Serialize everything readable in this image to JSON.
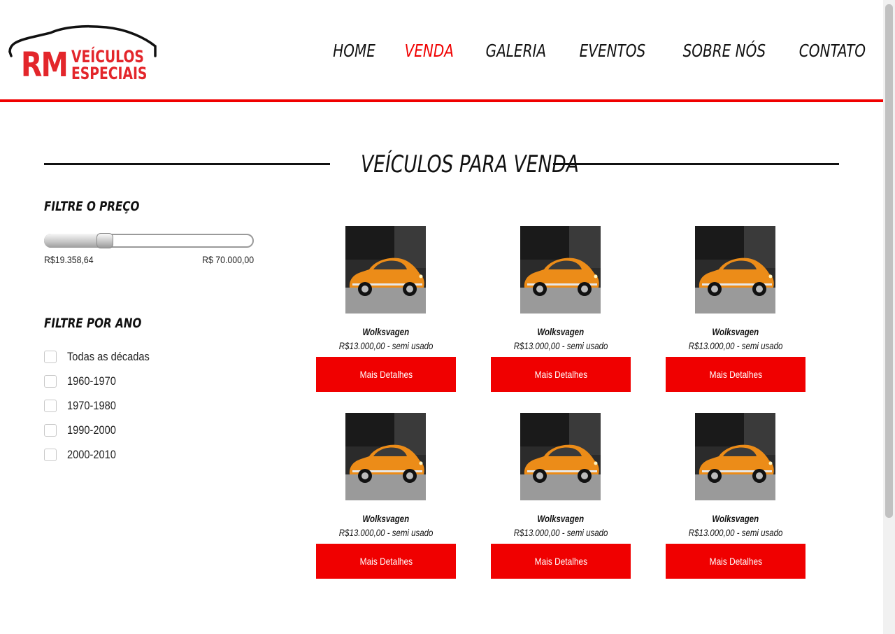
{
  "logo": {
    "initials": "RM",
    "line1": "VEÍCULOS",
    "line2": "ESPECIAIS",
    "color": "#e3262b"
  },
  "nav": [
    {
      "label": "HOME",
      "active": false
    },
    {
      "label": "VENDA",
      "active": true
    },
    {
      "label": "GALERIA",
      "active": false
    },
    {
      "label": "EVENTOS",
      "active": false
    },
    {
      "label": "SOBRE NÓS",
      "active": false
    },
    {
      "label": "CONTATO",
      "active": false
    }
  ],
  "section": {
    "title": "VEÍCULOS PARA VENDA"
  },
  "filters": {
    "price": {
      "heading": "FILTRE O PREÇO",
      "min_label": "R$19.358,64",
      "max_label": "R$ 70.000,00",
      "level_percent": 27
    },
    "year": {
      "heading": "FILTRE POR ANO",
      "options": [
        {
          "label": "Todas as décadas",
          "checked": false
        },
        {
          "label": "1960-1970",
          "checked": false
        },
        {
          "label": "1970-1980",
          "checked": false
        },
        {
          "label": "1990-2000",
          "checked": false
        },
        {
          "label": "2000-2010",
          "checked": false
        }
      ]
    }
  },
  "products": [
    {
      "name": "Wolksvagen",
      "price": "R$13.000,00 - semi usado",
      "button": "Mais Detalhes"
    },
    {
      "name": "Wolksvagen",
      "price": "R$13.000,00 - semi usado",
      "button": "Mais Detalhes"
    },
    {
      "name": "Wolksvagen",
      "price": "R$13.000,00 - semi usado",
      "button": "Mais Detalhes"
    },
    {
      "name": "Wolksvagen",
      "price": "R$13.000,00 - semi usado",
      "button": "Mais Detalhes"
    },
    {
      "name": "Wolksvagen",
      "price": "R$13.000,00 - semi usado",
      "button": "Mais Detalhes"
    },
    {
      "name": "Wolksvagen",
      "price": "R$13.000,00 - semi usado",
      "button": "Mais Detalhes"
    }
  ],
  "colors": {
    "accent": "#f00000",
    "car_body": "#ec8c18"
  }
}
